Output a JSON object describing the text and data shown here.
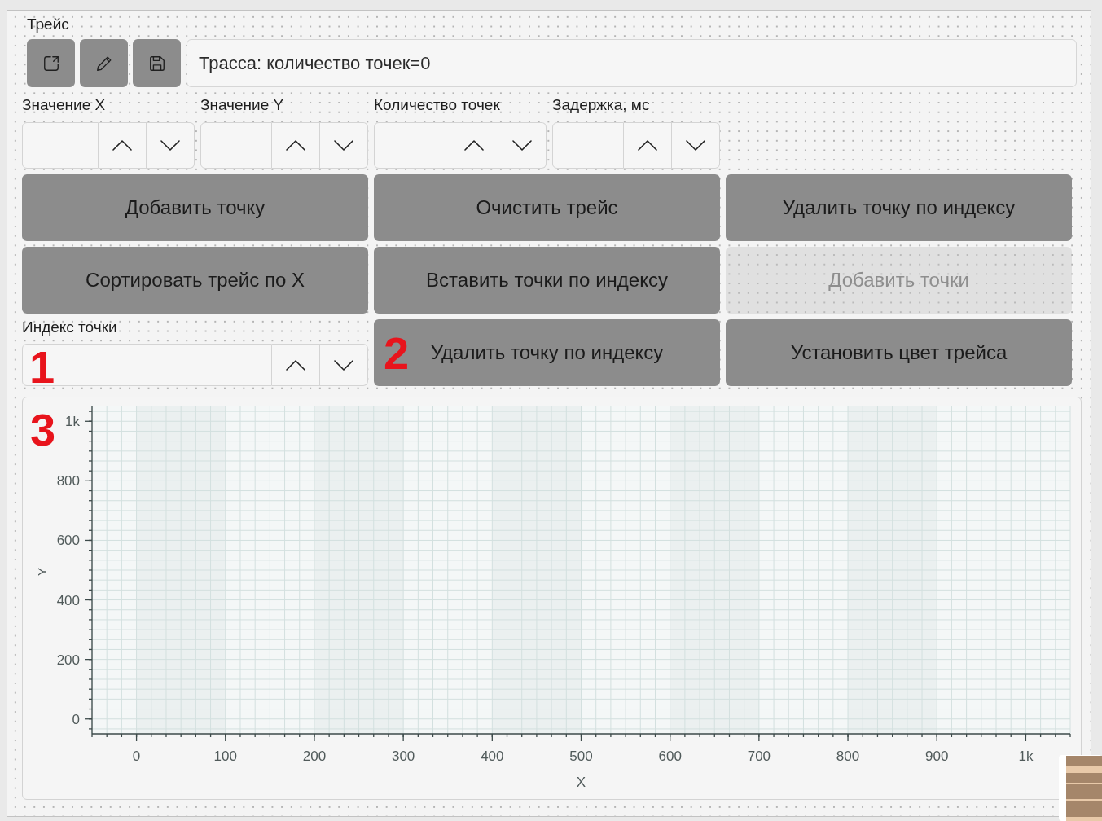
{
  "group": {
    "title": "Трейс"
  },
  "toolbar": [
    {
      "kind": "export"
    },
    {
      "kind": "edit"
    },
    {
      "kind": "save"
    }
  ],
  "info_field": {
    "value": "Трасса: количество точек=0"
  },
  "spinboxes": [
    {
      "label": "Значение X"
    },
    {
      "label": "Значение Y"
    },
    {
      "label": "Количество точек"
    },
    {
      "label": "Задержка, мс"
    }
  ],
  "buttons": [
    {
      "label": "Добавить точку",
      "disabled": false
    },
    {
      "label": "Очистить трейс",
      "disabled": false
    },
    {
      "label": "Удалить точку по индексу",
      "disabled": false
    },
    {
      "label": "Сортировать трейс по X",
      "disabled": false
    },
    {
      "label": "Вставить точки по индексу",
      "disabled": false
    },
    {
      "label": "Добавить точки",
      "disabled": true
    },
    {
      "label": "Удалить точку по индексу",
      "disabled": false,
      "annotation": "2"
    },
    {
      "label": "Установить цвет трейса",
      "disabled": false
    }
  ],
  "index_spinbox": {
    "label": "Индекс точки",
    "annotation": "1"
  },
  "chart": {
    "annotation": "3",
    "chart_data": {
      "type": "line",
      "xlabel": "X",
      "ylabel": "Y",
      "xlim": [
        -50,
        1050
      ],
      "ylim": [
        -50,
        1050
      ],
      "xticks": [
        0,
        100,
        200,
        300,
        400,
        500,
        600,
        700,
        800,
        900,
        {
          "value": 1000,
          "label": "1k"
        }
      ],
      "yticks": [
        0,
        200,
        400,
        600,
        800,
        {
          "value": 1000,
          "label": "1k"
        }
      ],
      "grid": true
    }
  }
}
